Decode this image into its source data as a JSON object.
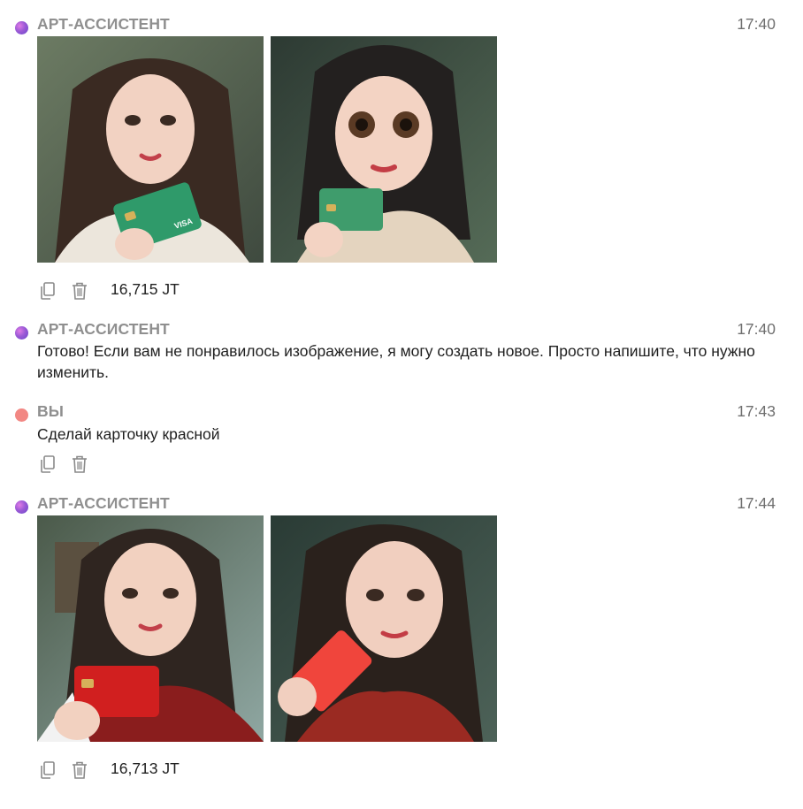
{
  "messages": [
    {
      "author": "АРТ-АССИСТЕНТ",
      "time": "17:40",
      "role": "assistant",
      "images": [
        {
          "icon": "portrait-green-card-image",
          "card_color": "#2f9a6a"
        },
        {
          "icon": "portrait-green-card-image",
          "card_color": "#3f9c6c"
        }
      ],
      "tokens": "16,715 JT"
    },
    {
      "author": "АРТ-АССИСТЕНТ",
      "time": "17:40",
      "role": "assistant",
      "text": "Готово! Если вам не понравилось изображение, я могу создать новое. Просто напишите, что нужно изменить."
    },
    {
      "author": "ВЫ",
      "time": "17:43",
      "role": "user",
      "text": "Сделай карточку красной"
    },
    {
      "author": "АРТ-АССИСТЕНТ",
      "time": "17:44",
      "role": "assistant",
      "images": [
        {
          "icon": "portrait-red-card-image",
          "card_color": "#d11f1f"
        },
        {
          "icon": "portrait-red-card-image",
          "card_color": "#f0453c"
        }
      ],
      "tokens": "16,713 JT"
    }
  ],
  "icons": {
    "copy": "copy-icon",
    "delete": "trash-icon"
  },
  "colors": {
    "assistant_dot": "#9b5ad6",
    "user_dot": "#f28783",
    "author": "#8f8f8f",
    "time": "#6f6f6f"
  }
}
